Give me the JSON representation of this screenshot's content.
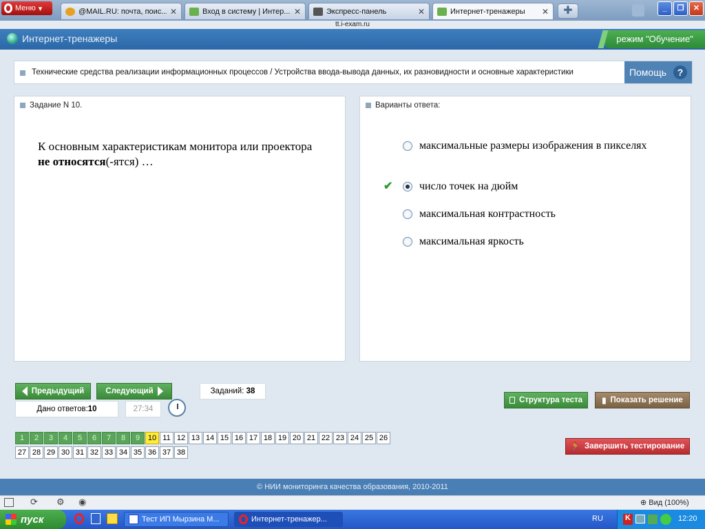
{
  "browser": {
    "menu_label": "Меню",
    "tabs": [
      {
        "title": "@MAIL.RU: почта, поис...",
        "icon": "mail-icon"
      },
      {
        "title": "Вход в систему | Интер...",
        "icon": "web-icon"
      },
      {
        "title": "Экспресс-панель",
        "icon": "grid-icon"
      },
      {
        "title": "Интернет-тренажеры",
        "icon": "web-icon",
        "active": true
      }
    ],
    "url": "tt.i-exam.ru"
  },
  "app": {
    "title": "Интернет-тренажеры",
    "mode": "режим \"Обучение\""
  },
  "breadcrumb": "Технические средства реализации информационных процессов / Устройства ввода-вывода данных, их разновидности и основные характеристики",
  "help_label": "Помощь",
  "help_icon": "?",
  "task": {
    "header": "Задание N 10.",
    "question_part1": "К основным характеристикам монитора или проектора ",
    "question_bold": "не относятся",
    "question_part2": "(-ятся) …"
  },
  "answers": {
    "header": "Варианты ответа:",
    "options": [
      {
        "text": "максимальные размеры изображения в пикселях",
        "selected": false
      },
      {
        "text": "число точек на дюйм",
        "selected": true,
        "correct": true
      },
      {
        "text": "максимальная контрастность",
        "selected": false
      },
      {
        "text": "максимальная яркость",
        "selected": false
      }
    ]
  },
  "controls": {
    "prev": "Предыдущий",
    "next": "Следующий",
    "tasks_label": "Заданий:",
    "tasks_count": "38",
    "answered_label": "Дано ответов:",
    "answered_count": "10",
    "timer": "27:34",
    "structure": "Структура теста",
    "show_solution": "Показать решение",
    "finish": "Завершить тестирование"
  },
  "numbers": {
    "row1": [
      "1",
      "2",
      "3",
      "4",
      "5",
      "6",
      "7",
      "8",
      "9",
      "10",
      "11",
      "12",
      "13",
      "14",
      "15",
      "16",
      "17",
      "18",
      "19",
      "20",
      "21",
      "22",
      "23",
      "24",
      "25",
      "26"
    ],
    "row2": [
      "27",
      "28",
      "29",
      "30",
      "31",
      "32",
      "33",
      "34",
      "35",
      "36",
      "37",
      "38"
    ],
    "done_count": 9,
    "current": "10"
  },
  "footer": "© НИИ мониторинга качества образования, 2010-2011",
  "statusbar": {
    "zoom": "Вид (100%)"
  },
  "taskbar": {
    "start": "пуск",
    "tasks": [
      {
        "title": "Тест ИП Мырзина М...",
        "icon": "word-icon"
      },
      {
        "title": "Интернет-тренажер...",
        "icon": "opera-icon"
      }
    ],
    "lang": "RU",
    "time": "12:20"
  }
}
